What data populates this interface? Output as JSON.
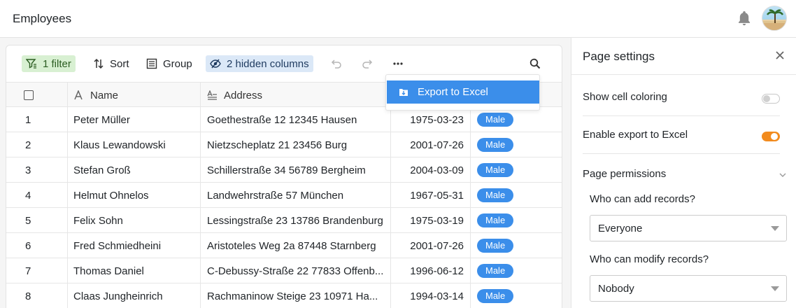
{
  "header": {
    "title": "Employees",
    "bell_icon": "bell-icon",
    "avatar_icon": "avatar"
  },
  "toolbar": {
    "filter_label": "1 filter",
    "sort_label": "Sort",
    "group_label": "Group",
    "hidden_label": "2 hidden columns"
  },
  "table": {
    "columns": {
      "name": "Name",
      "address": "Address"
    },
    "rows": [
      {
        "idx": "1",
        "name": "Peter Müller",
        "address": "Goethestraße 12 12345 Hausen",
        "date": "1975-03-23",
        "gender": "Male"
      },
      {
        "idx": "2",
        "name": "Klaus Lewandowski",
        "address": "Nietzscheplatz 21 23456 Burg",
        "date": "2001-07-26",
        "gender": "Male"
      },
      {
        "idx": "3",
        "name": "Stefan Groß",
        "address": "Schillerstraße 34 56789 Bergheim",
        "date": "2004-03-09",
        "gender": "Male"
      },
      {
        "idx": "4",
        "name": "Helmut Ohnelos",
        "address": "Landwehrstraße 57 München",
        "date": "1967-05-31",
        "gender": "Male"
      },
      {
        "idx": "5",
        "name": "Felix Sohn",
        "address": "Lessingstraße 23 13786 Brandenburg",
        "date": "1975-03-19",
        "gender": "Male"
      },
      {
        "idx": "6",
        "name": "Fred Schmiedheini",
        "address": "Aristoteles Weg 2a 87448 Starnberg",
        "date": "2001-07-26",
        "gender": "Male"
      },
      {
        "idx": "7",
        "name": "Thomas Daniel",
        "address": "C-Debussy-Straße 22 77833 Offenb...",
        "date": "1996-06-12",
        "gender": "Male"
      },
      {
        "idx": "8",
        "name": "Claas Jungheinrich",
        "address": "Rachmaninow Steige 23 10971 Ha...",
        "date": "1994-03-14",
        "gender": "Male"
      }
    ]
  },
  "dropdown": {
    "export_label": "Export to Excel"
  },
  "panel": {
    "title": "Page settings",
    "show_cell_coloring": {
      "label": "Show cell coloring",
      "enabled": false
    },
    "enable_export": {
      "label": "Enable export to Excel",
      "enabled": true
    },
    "permissions_label": "Page permissions",
    "add_records_label": "Who can add records?",
    "add_records_value": "Everyone",
    "modify_records_label": "Who can modify records?",
    "modify_records_value": "Nobody"
  },
  "colors": {
    "accent": "#3b8eea",
    "toggle_on": "#f28b1e",
    "filter_bg": "#d8f0d2",
    "hidden_bg": "#dbe8f7"
  }
}
